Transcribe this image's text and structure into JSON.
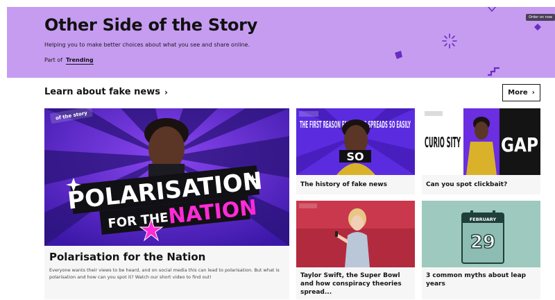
{
  "banner": {
    "title": "Other Side of the Story",
    "subtitle": "Helping you to make better choices about what you see and share online.",
    "part_of_label": "Part of",
    "part_of_link": "Trending",
    "order_chip": "Order on now"
  },
  "section": {
    "title": "Learn about fake news",
    "more_label": "More"
  },
  "featured": {
    "badge": "of the story",
    "headline_line1": "POLARISATION",
    "headline_line2_a": "FOR THE",
    "headline_line2_b": "NATION",
    "title": "Polarisation for the Nation",
    "description": "Everyone wants their views to be heard, and on social media this can lead to polarisation. But what is polarisation and how can you spot it? Watch our short video to find out!"
  },
  "cards": [
    {
      "title": "The history of fake news",
      "image_text": "THE FIRST REASON FAKE NEWS SPREADS SO EASILY"
    },
    {
      "title": "Can you spot clickbait?",
      "image_text_left": "CURIO SITY",
      "image_text_right": "GAP"
    },
    {
      "title": "Taylor Swift, the Super Bowl and how conspiracy theories spread..."
    },
    {
      "title": "3 common myths about leap years",
      "image_month": "FEBRUARY",
      "image_day": "29"
    }
  ],
  "colors": {
    "banner_bg": "#c69cf1",
    "accent_purple": "#7b2ee0",
    "accent_pink": "#ff2bd6",
    "calendar_bg": "#9ec9bf"
  },
  "icons": [
    "chevron-right-icon",
    "sparkle-icon",
    "diamond-icon",
    "zigzag-icon",
    "calendar-icon"
  ]
}
